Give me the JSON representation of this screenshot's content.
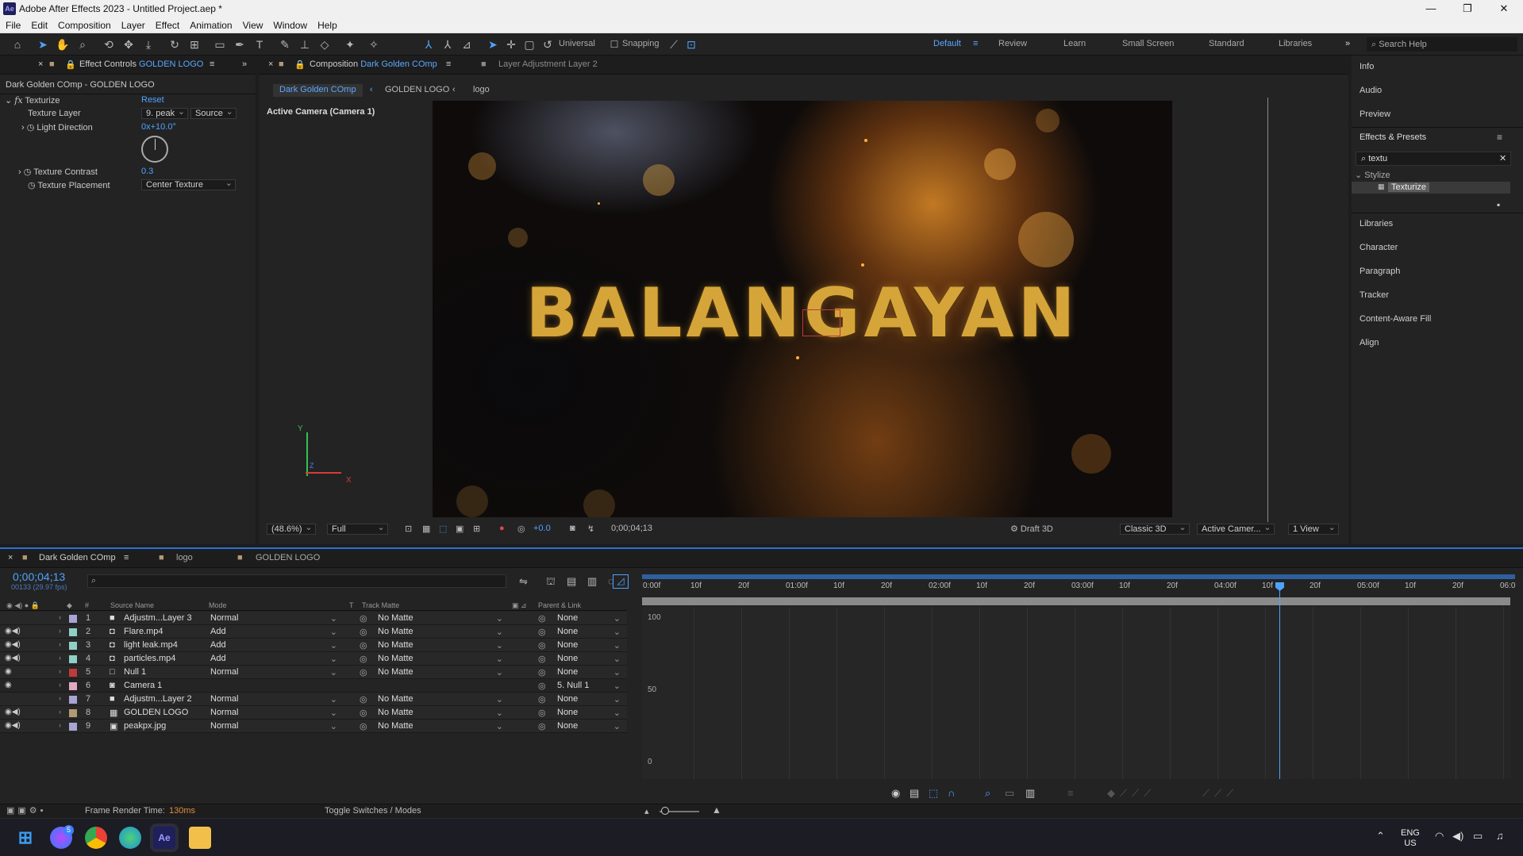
{
  "app": {
    "window_title": "Adobe After Effects 2023 - Untitled Project.aep *",
    "logo_text": "Ae",
    "minimize": "—",
    "maximize": "❐",
    "close": "✕"
  },
  "menu": [
    "File",
    "Edit",
    "Composition",
    "Layer",
    "Effect",
    "Animation",
    "View",
    "Window",
    "Help"
  ],
  "toolbar": {
    "axis_mode": "Universal",
    "snapping": "Snapping",
    "workspaces": [
      "Default",
      "Review",
      "Learn",
      "Small Screen",
      "Standard",
      "Libraries"
    ],
    "active_workspace": "Default",
    "search_help": "Search Help"
  },
  "effect_controls": {
    "tab_label": "Effect Controls",
    "tab_target": "GOLDEN LOGO",
    "breadcrumb": "Dark Golden COmp - GOLDEN LOGO",
    "effect_name": "Texturize",
    "reset_label": "Reset",
    "texture_layer_label": "Texture Layer",
    "texture_layer_value": "9. peak",
    "texture_layer_source": "Source",
    "light_direction_label": "Light Direction",
    "light_direction_value": "0x+10.0°",
    "texture_contrast_label": "Texture Contrast",
    "texture_contrast_value": "0.3",
    "texture_placement_label": "Texture Placement",
    "texture_placement_value": "Center Texture"
  },
  "composition": {
    "tab_prefix": "Composition",
    "tab_name": "Dark Golden COmp",
    "layer_tab": "Layer  Adjustment Layer 2",
    "breadcrumbs": [
      "Dark Golden COmp",
      "GOLDEN LOGO",
      "logo"
    ],
    "camera_label": "Active Camera (Camera 1)",
    "logo_text": "BALANGAYAN",
    "axis_y": "Y",
    "axis_x": "X",
    "axis_z": "Z",
    "zoom": "(48.6%)",
    "resolution": "Full",
    "exposure": "+0.0",
    "timecode": "0;00;04;13",
    "renderer_draft": "Draft 3D",
    "renderer": "Classic 3D",
    "view_camera": "Active Camer...",
    "view_count": "1 View"
  },
  "right_panel": {
    "info": "Info",
    "audio": "Audio",
    "preview": "Preview",
    "effects_presets": "Effects & Presets",
    "search_value": "textu",
    "category": "Stylize",
    "result": "Texturize",
    "libraries": "Libraries",
    "character": "Character",
    "paragraph": "Paragraph",
    "tracker": "Tracker",
    "content_aware_fill": "Content-Aware Fill",
    "align": "Align"
  },
  "timeline": {
    "tabs": [
      "Dark Golden COmp",
      "logo",
      "GOLDEN LOGO"
    ],
    "timecode": "0;00;04;13",
    "frame_info": "00133 (29.97 fps)",
    "columns": {
      "num": "#",
      "source": "Source Name",
      "mode": "Mode",
      "t": "T",
      "track_matte": "Track Matte",
      "parent": "Parent & Link"
    },
    "layers": [
      {
        "num": "1",
        "name": "Adjustm...Layer 3",
        "mode": "Normal",
        "matte": "No Matte",
        "parent": "None",
        "color": "#a9a4d6",
        "icon": "■"
      },
      {
        "num": "2",
        "name": "Flare.mp4",
        "mode": "Add",
        "matte": "No Matte",
        "parent": "None",
        "color": "#8fd0c6",
        "icon": "◘"
      },
      {
        "num": "3",
        "name": "light leak.mp4",
        "mode": "Add",
        "matte": "No Matte",
        "parent": "None",
        "color": "#8fd0c6",
        "icon": "◘"
      },
      {
        "num": "4",
        "name": "particles.mp4",
        "mode": "Add",
        "matte": "No Matte",
        "parent": "None",
        "color": "#8fd0c6",
        "icon": "◘"
      },
      {
        "num": "5",
        "name": "Null 1",
        "mode": "Normal",
        "matte": "No Matte",
        "parent": "None",
        "color": "#c0393b",
        "icon": "□"
      },
      {
        "num": "6",
        "name": "Camera 1",
        "mode": "",
        "matte": "",
        "parent": "5. Null 1",
        "color": "#e1a9c2",
        "icon": "◙"
      },
      {
        "num": "7",
        "name": "Adjustm...Layer 2",
        "mode": "Normal",
        "matte": "No Matte",
        "parent": "None",
        "color": "#a9a4d6",
        "icon": "■"
      },
      {
        "num": "8",
        "name": "GOLDEN LOGO",
        "mode": "Normal",
        "matte": "No Matte",
        "parent": "None",
        "color": "#b19a74",
        "icon": "▦"
      },
      {
        "num": "9",
        "name": "peakpx.jpg",
        "mode": "Normal",
        "matte": "No Matte",
        "parent": "None",
        "color": "#a9a4d6",
        "icon": "▣"
      }
    ],
    "ruler": [
      "0:00f",
      "10f",
      "20f",
      "01:00f",
      "10f",
      "20f",
      "02:00f",
      "10f",
      "20f",
      "03:00f",
      "10f",
      "20f",
      "04:00f",
      "10f",
      "20f",
      "05:00f",
      "10f",
      "20f",
      "06:0"
    ],
    "graph_labels": [
      "100",
      "50",
      "0"
    ],
    "frame_render_label": "Frame Render Time:",
    "frame_render_value": "130ms",
    "toggle_label": "Toggle Switches / Modes"
  },
  "taskbar": {
    "lang": "ENG",
    "region": "US",
    "messenger_badge": "5",
    "ae_label": "Ae"
  },
  "colors": {
    "accent": "#4ea3ff",
    "gold": "#d6a53a",
    "panel_bg": "#232323"
  }
}
